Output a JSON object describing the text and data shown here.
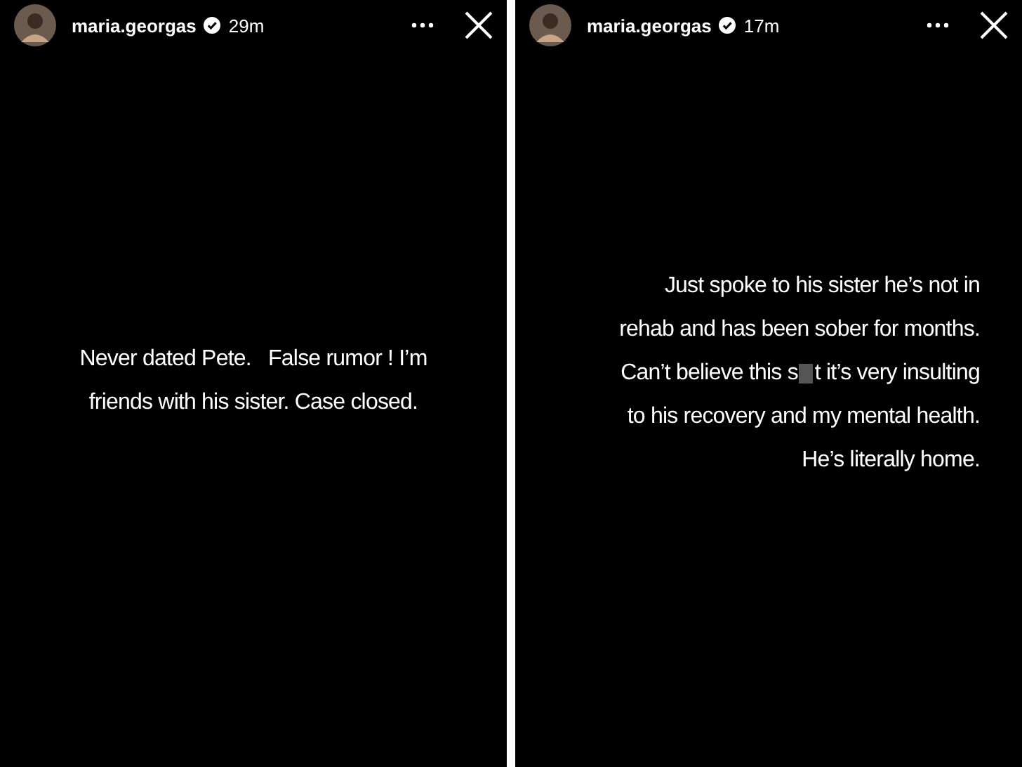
{
  "stories": [
    {
      "username": "maria.georgas",
      "verified": true,
      "time": "29m",
      "kind": "centered",
      "lines": [
        {
          "kind": "plain",
          "text": "Never dated Pete.   False rumor ! I’m"
        },
        {
          "kind": "plain",
          "text": "friends with his sister. Case closed."
        }
      ]
    },
    {
      "username": "maria.georgas",
      "verified": true,
      "time": "17m",
      "kind": "right-aligned",
      "lines": [
        {
          "kind": "plain",
          "text": "Just spoke to his sister he’s not in"
        },
        {
          "kind": "plain",
          "text": "rehab and has been sober for months."
        },
        {
          "kind": "censored",
          "before": "Can’t believe this s",
          "after": "t it’s very insulting"
        },
        {
          "kind": "plain",
          "text": "to his recovery and my mental health."
        },
        {
          "kind": "plain",
          "text": "He’s literally home."
        }
      ]
    }
  ]
}
